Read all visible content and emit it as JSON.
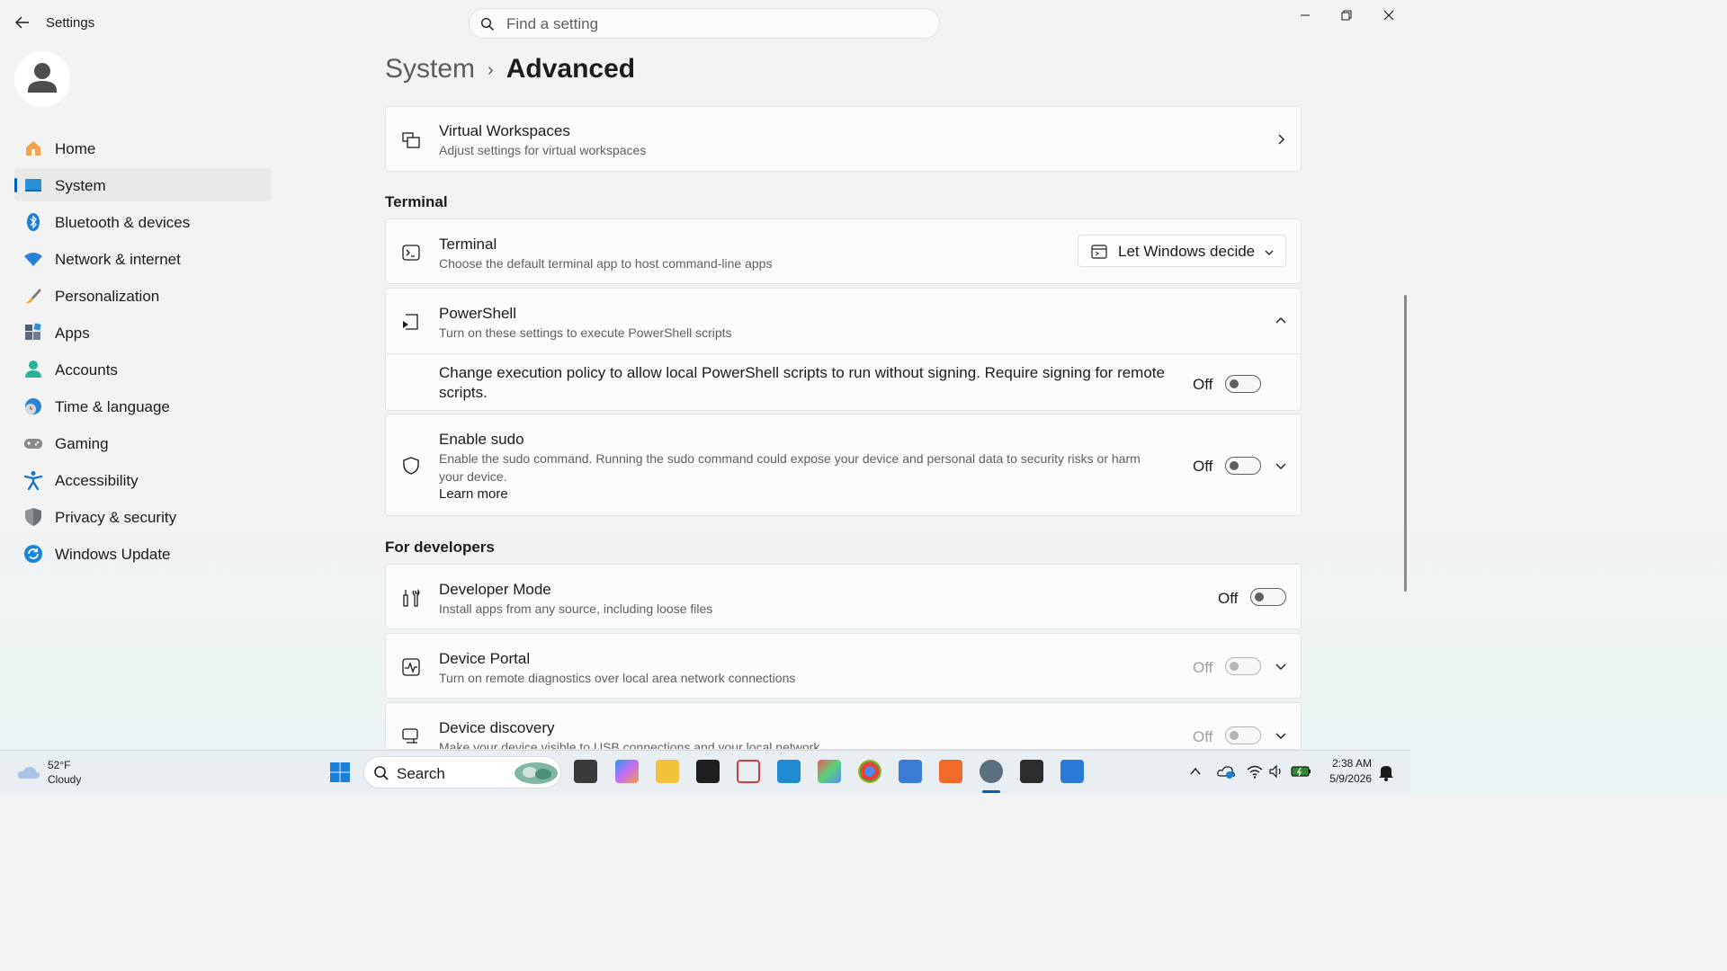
{
  "window": {
    "title": "Settings"
  },
  "search": {
    "placeholder": "Find a setting"
  },
  "nav": {
    "items": [
      {
        "label": "Home",
        "icon": "home-icon"
      },
      {
        "label": "System",
        "icon": "system-icon",
        "active": true
      },
      {
        "label": "Bluetooth & devices",
        "icon": "bluetooth-icon"
      },
      {
        "label": "Network & internet",
        "icon": "wifi-icon"
      },
      {
        "label": "Personalization",
        "icon": "brush-icon"
      },
      {
        "label": "Apps",
        "icon": "apps-icon"
      },
      {
        "label": "Accounts",
        "icon": "accounts-icon"
      },
      {
        "label": "Time & language",
        "icon": "time-language-icon"
      },
      {
        "label": "Gaming",
        "icon": "gamepad-icon"
      },
      {
        "label": "Accessibility",
        "icon": "accessibility-icon"
      },
      {
        "label": "Privacy & security",
        "icon": "shield-icon"
      },
      {
        "label": "Windows Update",
        "icon": "update-icon"
      }
    ]
  },
  "breadcrumb": {
    "parent": "System",
    "separator": "›",
    "current": "Advanced"
  },
  "virtual_workspaces": {
    "title": "Virtual Workspaces",
    "desc": "Adjust settings for virtual workspaces"
  },
  "terminal_section": {
    "heading": "Terminal"
  },
  "terminal": {
    "title": "Terminal",
    "desc": "Choose the default terminal app to host command-line apps",
    "dropdown_value": "Let Windows decide"
  },
  "powershell": {
    "title": "PowerShell",
    "desc": "Turn on these settings to execute PowerShell scripts",
    "policy_text": "Change execution policy to allow local PowerShell scripts to run without signing. Require signing for remote scripts.",
    "policy_state": "Off"
  },
  "sudo": {
    "title": "Enable sudo",
    "desc": "Enable the sudo command. Running the sudo command could expose your device and personal data to security risks or harm your device.",
    "link": "Learn more",
    "state": "Off"
  },
  "dev_section": {
    "heading": "For developers"
  },
  "developer_mode": {
    "title": "Developer Mode",
    "desc": "Install apps from any source, including loose files",
    "state": "Off"
  },
  "device_portal": {
    "title": "Device Portal",
    "desc": "Turn on remote diagnostics over local area network connections",
    "state": "Off"
  },
  "device_discovery": {
    "title": "Device discovery",
    "desc": "Make your device visible to USB connections and your local network",
    "state": "Off"
  },
  "taskbar": {
    "weather_temp": "52°F",
    "weather_cond": "Cloudy",
    "search_label": "Search",
    "time": "2:38 AM",
    "date": "5/9/2026"
  },
  "colors": {
    "accent": "#005fb8",
    "background": "#f3f3f3",
    "card": "#fbfbfb"
  }
}
